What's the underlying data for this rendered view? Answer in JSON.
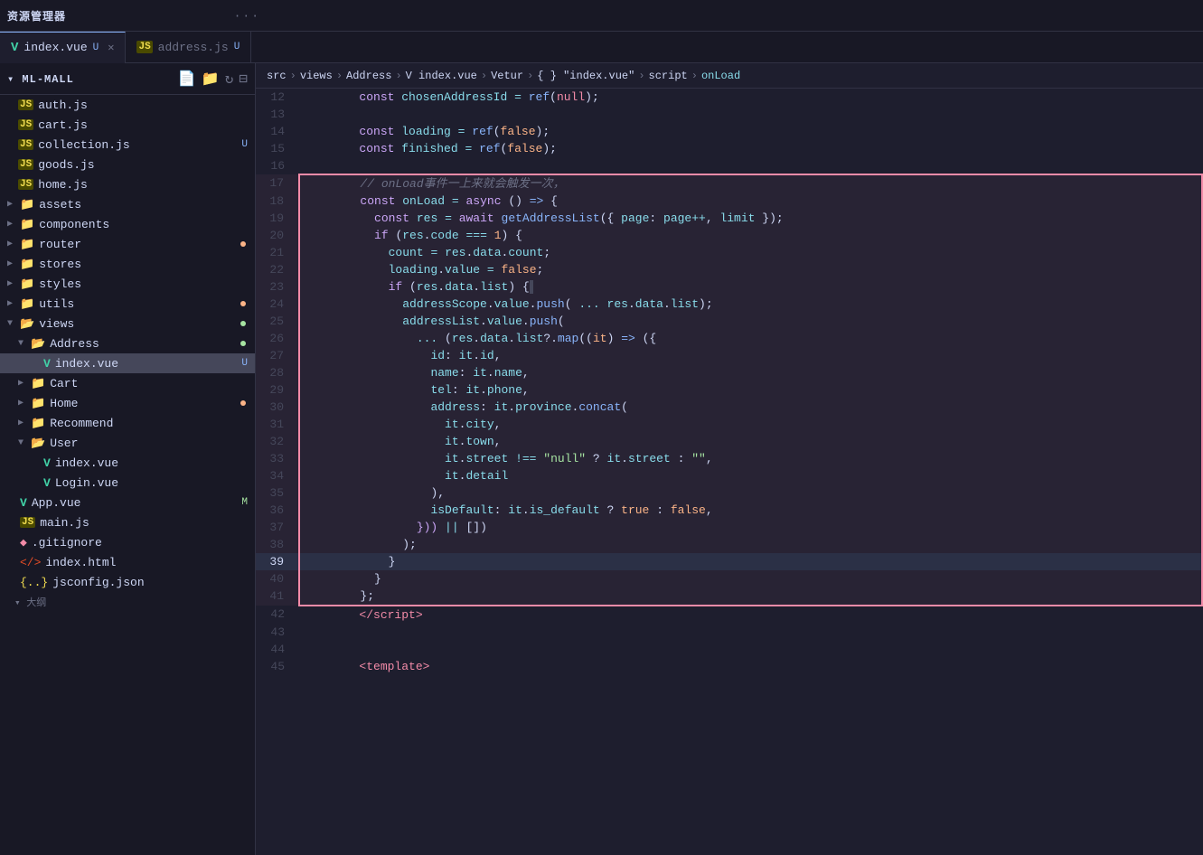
{
  "titlebar": {
    "explorer_label": "资源管理器",
    "dots": "···"
  },
  "tabs": [
    {
      "id": "index-vue",
      "label": "index.vue",
      "type": "vue",
      "active": true,
      "modified": "U",
      "closeable": true
    },
    {
      "id": "address-js",
      "label": "address.js",
      "type": "js",
      "active": false,
      "modified": "U",
      "closeable": false
    }
  ],
  "breadcrumb": {
    "items": [
      "src",
      "views",
      "Address",
      "index.vue",
      "Vetur",
      "{ } \"index.vue\"",
      "script",
      "onLoad"
    ]
  },
  "sidebar": {
    "toolbar_title": "资源管理器",
    "root": "ML-MALL",
    "items": [
      {
        "id": "auth",
        "indent": 1,
        "type": "js",
        "label": "auth.js",
        "badge": null
      },
      {
        "id": "cart",
        "indent": 1,
        "type": "js",
        "label": "cart.js",
        "badge": null
      },
      {
        "id": "collection",
        "indent": 1,
        "type": "js",
        "label": "collection.js",
        "badge": "U"
      },
      {
        "id": "goods",
        "indent": 1,
        "type": "js",
        "label": "goods.js",
        "badge": null
      },
      {
        "id": "home",
        "indent": 1,
        "type": "js",
        "label": "home.js",
        "badge": null
      },
      {
        "id": "assets",
        "indent": 0,
        "type": "folder",
        "label": "assets",
        "badge": null,
        "collapsed": true
      },
      {
        "id": "components",
        "indent": 0,
        "type": "folder",
        "label": "components",
        "badge": null,
        "collapsed": true
      },
      {
        "id": "router",
        "indent": 0,
        "type": "folder",
        "label": "router",
        "badge": "dot-orange",
        "collapsed": true
      },
      {
        "id": "stores",
        "indent": 0,
        "type": "folder",
        "label": "stores",
        "badge": null,
        "collapsed": true
      },
      {
        "id": "styles",
        "indent": 0,
        "type": "folder",
        "label": "styles",
        "badge": null,
        "collapsed": true
      },
      {
        "id": "utils",
        "indent": 0,
        "type": "folder",
        "label": "utils",
        "badge": "dot-orange",
        "collapsed": true
      },
      {
        "id": "views",
        "indent": 0,
        "type": "folder",
        "label": "views",
        "badge": "dot-green",
        "collapsed": false
      },
      {
        "id": "address-folder",
        "indent": 1,
        "type": "folder",
        "label": "Address",
        "badge": "dot-green",
        "collapsed": false
      },
      {
        "id": "index-vue-file",
        "indent": 2,
        "type": "vue",
        "label": "index.vue",
        "badge": "U",
        "active": true
      },
      {
        "id": "cart-folder",
        "indent": 1,
        "type": "folder",
        "label": "Cart",
        "badge": null,
        "collapsed": true
      },
      {
        "id": "home-folder",
        "indent": 1,
        "type": "folder",
        "label": "Home",
        "badge": "dot-orange",
        "collapsed": true
      },
      {
        "id": "recommend-folder",
        "indent": 1,
        "type": "folder",
        "label": "Recommend",
        "badge": null,
        "collapsed": true
      },
      {
        "id": "user-folder",
        "indent": 1,
        "type": "folder",
        "label": "User",
        "badge": null,
        "collapsed": false
      },
      {
        "id": "user-index",
        "indent": 2,
        "type": "vue",
        "label": "index.vue",
        "badge": null
      },
      {
        "id": "user-login",
        "indent": 2,
        "type": "vue",
        "label": "Login.vue",
        "badge": null
      },
      {
        "id": "app-vue",
        "indent": 0,
        "type": "vue",
        "label": "App.vue",
        "badge": "M"
      },
      {
        "id": "main-js",
        "indent": 0,
        "type": "js",
        "label": "main.js",
        "badge": null
      },
      {
        "id": "gitignore",
        "indent": 0,
        "type": "git",
        "label": ".gitignore",
        "badge": null
      },
      {
        "id": "index-html",
        "indent": 0,
        "type": "html",
        "label": "index.html",
        "badge": null
      },
      {
        "id": "jsconfig",
        "indent": 0,
        "type": "json",
        "label": "jsconfig.json",
        "badge": null
      }
    ]
  },
  "code": {
    "lines": [
      {
        "num": 12,
        "highlight": false
      },
      {
        "num": 13,
        "highlight": false
      },
      {
        "num": 14,
        "highlight": false
      },
      {
        "num": 15,
        "highlight": false
      },
      {
        "num": 16,
        "highlight": false
      },
      {
        "num": 17,
        "highlight": true
      },
      {
        "num": 18,
        "highlight": true
      },
      {
        "num": 19,
        "highlight": true
      },
      {
        "num": 20,
        "highlight": true
      },
      {
        "num": 21,
        "highlight": true
      },
      {
        "num": 22,
        "highlight": true
      },
      {
        "num": 23,
        "highlight": true
      },
      {
        "num": 24,
        "highlight": true
      },
      {
        "num": 25,
        "highlight": true
      },
      {
        "num": 26,
        "highlight": true
      },
      {
        "num": 27,
        "highlight": true
      },
      {
        "num": 28,
        "highlight": true
      },
      {
        "num": 29,
        "highlight": true
      },
      {
        "num": 30,
        "highlight": true
      },
      {
        "num": 31,
        "highlight": true
      },
      {
        "num": 32,
        "highlight": true
      },
      {
        "num": 33,
        "highlight": true
      },
      {
        "num": 34,
        "highlight": true
      },
      {
        "num": 35,
        "highlight": true
      },
      {
        "num": 36,
        "highlight": true
      },
      {
        "num": 37,
        "highlight": true
      },
      {
        "num": 38,
        "highlight": true
      },
      {
        "num": 39,
        "highlight": true
      },
      {
        "num": 40,
        "highlight": true
      },
      {
        "num": 41,
        "highlight": true
      },
      {
        "num": 42,
        "highlight": false
      },
      {
        "num": 43,
        "highlight": false
      },
      {
        "num": 44,
        "highlight": false
      },
      {
        "num": 45,
        "highlight": false
      }
    ]
  }
}
